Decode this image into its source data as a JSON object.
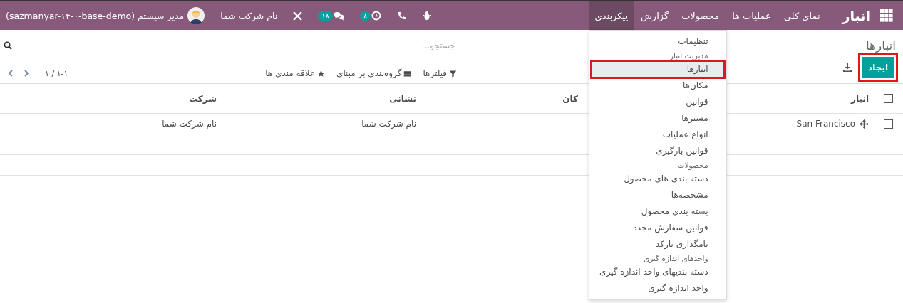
{
  "navbar": {
    "brand": "انبار",
    "menu": [
      {
        "label": "نمای کلی",
        "selected": false
      },
      {
        "label": "عملیات ها",
        "selected": false
      },
      {
        "label": "محصولات",
        "selected": false
      },
      {
        "label": "گزارش",
        "selected": false
      },
      {
        "label": "پیکربندی",
        "selected": true
      }
    ],
    "systray": {
      "activities_badge": "۸",
      "messages_badge": "۱۸",
      "company": "نام شرکت شما",
      "user": "مدیر سیستم (sazmanyar-۱۴-۰-base-demo)"
    }
  },
  "dropdown": [
    {
      "kind": "item",
      "label": "تنظیمات",
      "selected": false,
      "highlighted": false
    },
    {
      "kind": "header",
      "label": "مدیریت انبار"
    },
    {
      "kind": "item",
      "label": "انبارها",
      "selected": true,
      "highlighted": true
    },
    {
      "kind": "item",
      "label": "مکان‌ها",
      "selected": false,
      "highlighted": false
    },
    {
      "kind": "item",
      "label": "قوانین",
      "selected": false,
      "highlighted": false
    },
    {
      "kind": "item",
      "label": "مسیرها",
      "selected": false,
      "highlighted": false
    },
    {
      "kind": "item",
      "label": "انواع عملیات",
      "selected": false,
      "highlighted": false
    },
    {
      "kind": "item",
      "label": "قوانین بارگیری",
      "selected": false,
      "highlighted": false
    },
    {
      "kind": "header",
      "label": "محصولات"
    },
    {
      "kind": "item",
      "label": "دسته بندی های محصول",
      "selected": false,
      "highlighted": false
    },
    {
      "kind": "item",
      "label": "مشخصه‌ها",
      "selected": false,
      "highlighted": false
    },
    {
      "kind": "item",
      "label": "بسته بندی محصول",
      "selected": false,
      "highlighted": false
    },
    {
      "kind": "item",
      "label": "قوانین سفارش مجدد",
      "selected": false,
      "highlighted": false
    },
    {
      "kind": "item",
      "label": "نامگذاری بارکد",
      "selected": false,
      "highlighted": false
    },
    {
      "kind": "header",
      "label": "واحدهای اندازه گیری"
    },
    {
      "kind": "item",
      "label": "دسته بندیهای واحد اندازه گیری",
      "selected": false,
      "highlighted": false
    },
    {
      "kind": "item",
      "label": "واحد اندازه گیری",
      "selected": false,
      "highlighted": false
    }
  ],
  "control_panel": {
    "breadcrumb": "انبارها",
    "create_button": {
      "label": "ایجاد",
      "highlighted": true
    },
    "search": {
      "placeholder": "جستجو..."
    },
    "filters": [
      "فیلترها",
      "گروه‌بندی بر مبنای",
      "علاقه مندی ها"
    ],
    "pager": "۱-۱ / ۱"
  },
  "table": {
    "select_all_checked": false,
    "columns": [
      "انبار",
      "کان",
      "نشانی",
      "شرکت"
    ],
    "rows": [
      {
        "checked": false,
        "cells": [
          "San Francisco",
          "",
          "نام شرکت شما",
          "نام شرکت شما"
        ]
      }
    ]
  }
}
